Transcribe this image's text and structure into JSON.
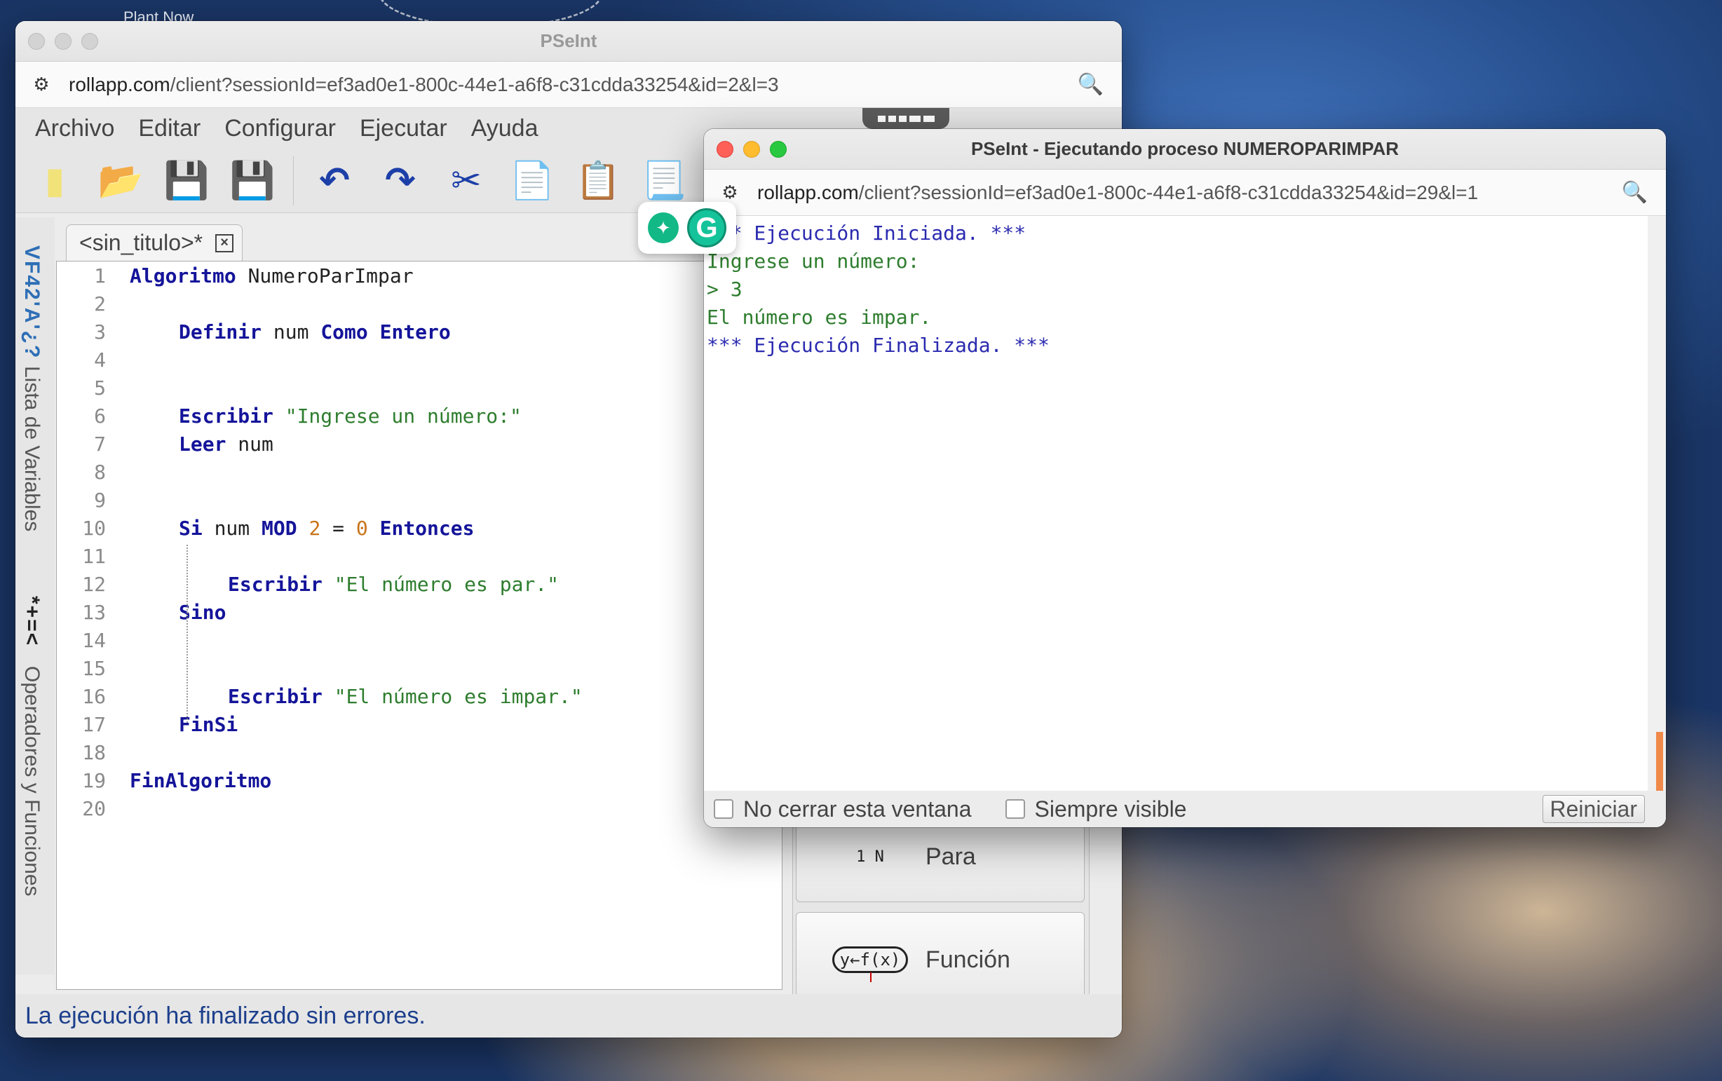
{
  "desktop": {
    "label": "Plant Now"
  },
  "main_window": {
    "title": "PSeInt",
    "url_host": "rollapp.com",
    "url_path": "/client?sessionId=ef3ad0e1-800c-44e1-a6f8-c31cdda33254&id=2&l=3",
    "menu": [
      "Archivo",
      "Editar",
      "Configurar",
      "Ejecutar",
      "Ayuda"
    ],
    "toolbar": [
      "new-file",
      "open-file",
      "save",
      "save-as",
      "undo",
      "redo",
      "cut",
      "copy",
      "paste",
      "find"
    ],
    "sidebar": {
      "icons_label": "VF42'A'¿?",
      "variables": "Lista de Variables",
      "ops_icons": "*+=<",
      "operators": "Operadores y Funciones"
    },
    "tab": {
      "label": "<sin_titulo>*",
      "close": "×"
    },
    "code_lines": [
      {
        "n": "1",
        "tokens": [
          [
            "kw",
            "Algoritmo"
          ],
          [
            "t",
            " NumeroParImpar"
          ]
        ],
        "indent": 0
      },
      {
        "n": "2",
        "tokens": [],
        "indent": 0
      },
      {
        "n": "3",
        "tokens": [
          [
            "kw",
            "Definir"
          ],
          [
            "t",
            " num "
          ],
          [
            "kw",
            "Como Entero"
          ]
        ],
        "indent": 1
      },
      {
        "n": "4",
        "tokens": [],
        "indent": 0
      },
      {
        "n": "5",
        "tokens": [],
        "indent": 0
      },
      {
        "n": "6",
        "tokens": [
          [
            "kw",
            "Escribir"
          ],
          [
            "t",
            " "
          ],
          [
            "str",
            "\"Ingrese un número:\""
          ]
        ],
        "indent": 1
      },
      {
        "n": "7",
        "tokens": [
          [
            "kw",
            "Leer"
          ],
          [
            "t",
            " num"
          ]
        ],
        "indent": 1
      },
      {
        "n": "8",
        "tokens": [],
        "indent": 0
      },
      {
        "n": "9",
        "tokens": [],
        "indent": 0
      },
      {
        "n": "10",
        "tokens": [
          [
            "kw",
            "Si"
          ],
          [
            "t",
            " num "
          ],
          [
            "kw",
            "MOD"
          ],
          [
            "t",
            " "
          ],
          [
            "num",
            "2"
          ],
          [
            "t",
            " = "
          ],
          [
            "num",
            "0"
          ],
          [
            "t",
            " "
          ],
          [
            "kw",
            "Entonces"
          ]
        ],
        "indent": 1
      },
      {
        "n": "11",
        "tokens": [],
        "indent": 0
      },
      {
        "n": "12",
        "tokens": [
          [
            "kw",
            "Escribir"
          ],
          [
            "t",
            " "
          ],
          [
            "str",
            "\"El número es par.\""
          ]
        ],
        "indent": 2
      },
      {
        "n": "13",
        "tokens": [
          [
            "kw",
            "Sino"
          ]
        ],
        "indent": 1
      },
      {
        "n": "14",
        "tokens": [],
        "indent": 0
      },
      {
        "n": "15",
        "tokens": [],
        "indent": 0
      },
      {
        "n": "16",
        "tokens": [
          [
            "kw",
            "Escribir"
          ],
          [
            "t",
            " "
          ],
          [
            "str",
            "\"El número es impar.\""
          ]
        ],
        "indent": 2
      },
      {
        "n": "17",
        "tokens": [
          [
            "kw",
            "FinSi"
          ]
        ],
        "indent": 1
      },
      {
        "n": "18",
        "tokens": [],
        "indent": 0
      },
      {
        "n": "19",
        "tokens": [
          [
            "kw",
            "FinAlgoritmo"
          ]
        ],
        "indent": 0
      },
      {
        "n": "20",
        "tokens": [],
        "indent": 0
      }
    ],
    "commands": {
      "para": "Para",
      "funcion": "Función",
      "fx_label": "y←f(x)",
      "para_icon": "1 N"
    },
    "status": "La ejecución ha finalizado sin errores."
  },
  "exec_window": {
    "title": "PSeInt - Ejecutando proceso NUMEROPARIMPAR",
    "url_host": "rollapp.com",
    "url_path": "/client?sessionId=ef3ad0e1-800c-44e1-a6f8-c31cdda33254&id=29&l=1",
    "console": [
      {
        "text": "*** Ejecución Iniciada. ***",
        "color": "blue"
      },
      {
        "text": "Ingrese un número:",
        "color": "green"
      },
      {
        "text": "> 3",
        "color": "green"
      },
      {
        "text": "El número es impar.",
        "color": "green"
      },
      {
        "text": "*** Ejecución Finalizada. ***",
        "color": "blue"
      }
    ],
    "no_close_label": "No cerrar esta ventana",
    "always_visible_label": "Siempre visible",
    "restart_label": "Reiniciar"
  },
  "colors": {
    "keyword": "#14149a",
    "string": "#2e7d2e",
    "number": "#c8741a",
    "console_blue": "#2a2ab0",
    "status_text": "#1c3f8c"
  }
}
